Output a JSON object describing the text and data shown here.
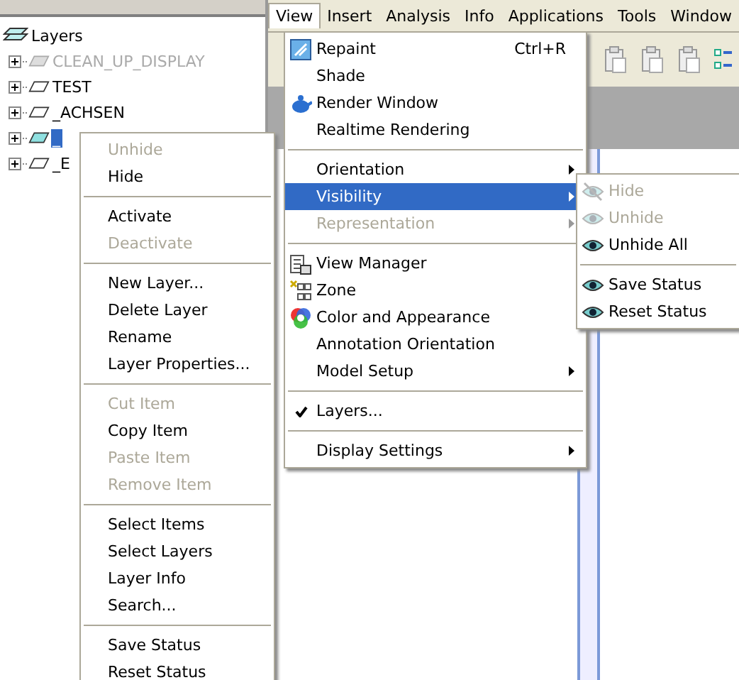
{
  "tree": {
    "root": "Layers",
    "items": [
      {
        "label": "CLEAN_UP_DISPLAY",
        "disabled": true,
        "selected": false
      },
      {
        "label": "TEST",
        "disabled": false,
        "selected": false
      },
      {
        "label": "_ACHSEN",
        "disabled": false,
        "selected": false
      },
      {
        "label": "_",
        "disabled": false,
        "selected": true
      },
      {
        "label": "_E",
        "disabled": false,
        "selected": false
      }
    ]
  },
  "menubar": [
    {
      "label": "View",
      "selected": true
    },
    {
      "label": "Insert",
      "selected": false
    },
    {
      "label": "Analysis",
      "selected": false
    },
    {
      "label": "Info",
      "selected": false
    },
    {
      "label": "Applications",
      "selected": false
    },
    {
      "label": "Tools",
      "selected": false
    },
    {
      "label": "Window",
      "selected": false
    }
  ],
  "view_menu": [
    {
      "kind": "item",
      "label": "Repaint",
      "shortcut": "Ctrl+R"
    },
    {
      "kind": "item",
      "label": "Shade"
    },
    {
      "kind": "item",
      "label": "Render Window"
    },
    {
      "kind": "item",
      "label": "Realtime Rendering"
    },
    {
      "kind": "separator"
    },
    {
      "kind": "item",
      "label": "Orientation",
      "submenu": true
    },
    {
      "kind": "item",
      "label": "Visibility",
      "submenu": true,
      "selected": true
    },
    {
      "kind": "item",
      "label": "Representation",
      "submenu": true,
      "disabled": true
    },
    {
      "kind": "separator"
    },
    {
      "kind": "item",
      "label": "View Manager"
    },
    {
      "kind": "item",
      "label": "Zone"
    },
    {
      "kind": "item",
      "label": "Color and Appearance"
    },
    {
      "kind": "item",
      "label": "Annotation Orientation"
    },
    {
      "kind": "item",
      "label": "Model Setup",
      "submenu": true
    },
    {
      "kind": "separator"
    },
    {
      "kind": "item",
      "label": "Layers...",
      "checked": true
    },
    {
      "kind": "separator"
    },
    {
      "kind": "item",
      "label": "Display Settings",
      "submenu": true
    }
  ],
  "visibility_menu": [
    {
      "kind": "item",
      "label": "Hide",
      "disabled": true
    },
    {
      "kind": "item",
      "label": "Unhide",
      "disabled": true
    },
    {
      "kind": "item",
      "label": "Unhide All"
    },
    {
      "kind": "separator"
    },
    {
      "kind": "item",
      "label": "Save Status"
    },
    {
      "kind": "item",
      "label": "Reset Status"
    }
  ],
  "context_menu": [
    {
      "kind": "item",
      "label": "Unhide",
      "disabled": true
    },
    {
      "kind": "item",
      "label": "Hide"
    },
    {
      "kind": "separator"
    },
    {
      "kind": "item",
      "label": "Activate"
    },
    {
      "kind": "item",
      "label": "Deactivate",
      "disabled": true
    },
    {
      "kind": "separator"
    },
    {
      "kind": "item",
      "label": "New Layer..."
    },
    {
      "kind": "item",
      "label": "Delete Layer"
    },
    {
      "kind": "item",
      "label": "Rename"
    },
    {
      "kind": "item",
      "label": "Layer Properties..."
    },
    {
      "kind": "separator"
    },
    {
      "kind": "item",
      "label": "Cut Item",
      "disabled": true
    },
    {
      "kind": "item",
      "label": "Copy Item"
    },
    {
      "kind": "item",
      "label": "Paste Item",
      "disabled": true
    },
    {
      "kind": "item",
      "label": "Remove Item",
      "disabled": true
    },
    {
      "kind": "separator"
    },
    {
      "kind": "item",
      "label": "Select Items"
    },
    {
      "kind": "item",
      "label": "Select Layers"
    },
    {
      "kind": "item",
      "label": "Layer Info"
    },
    {
      "kind": "item",
      "label": "Search..."
    },
    {
      "kind": "separator"
    },
    {
      "kind": "item",
      "label": "Save Status"
    },
    {
      "kind": "item",
      "label": "Reset Status"
    }
  ]
}
